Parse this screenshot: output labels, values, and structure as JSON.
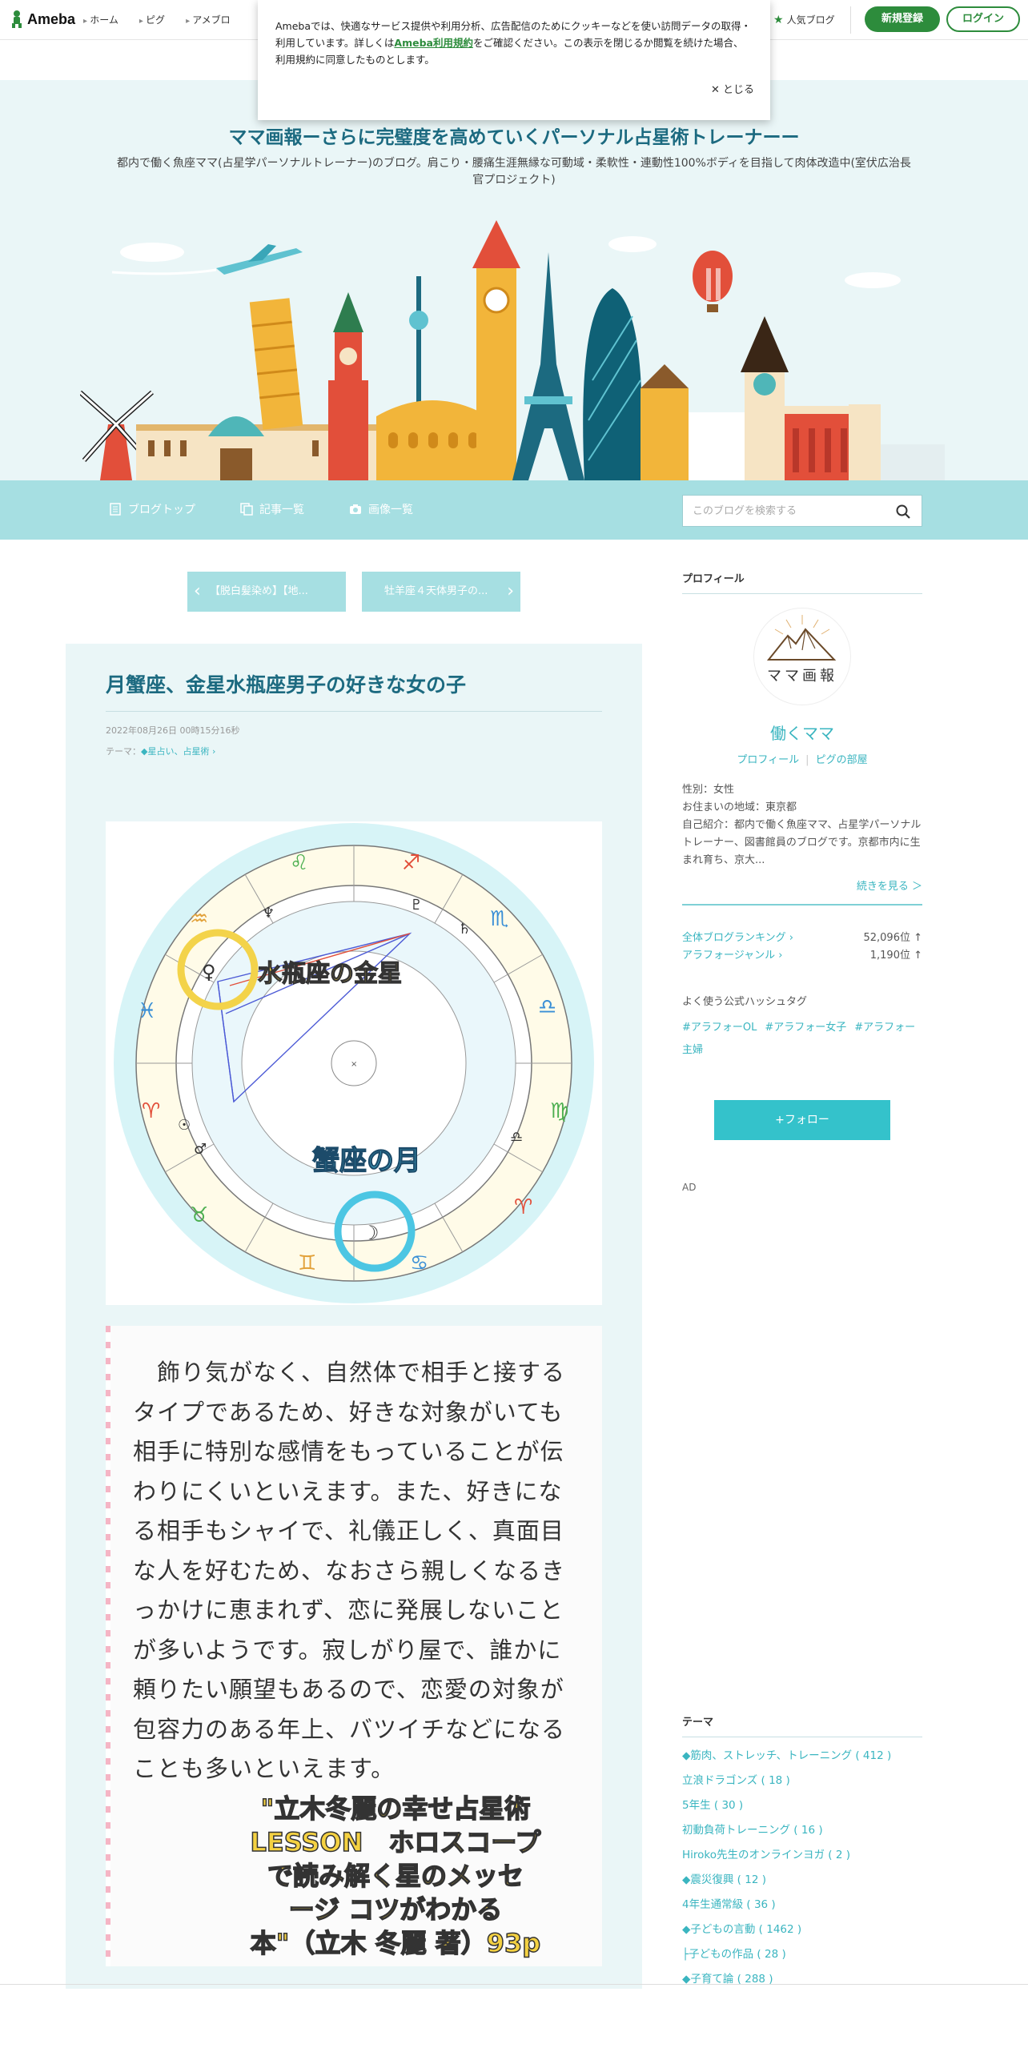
{
  "topbar": {
    "logo": "Ameba",
    "nav": [
      "ホーム",
      "ピグ",
      "アメブロ"
    ],
    "popular": "人気ブログ",
    "register": "新規登録",
    "login": "ログイン"
  },
  "cookie": {
    "text_before": "Amebaでは、快適なサービス提供や利用分析、広告配信のためにクッキーなどを使い訪問データの取得・利用しています。詳しくは",
    "link": "Ameba利用規約",
    "text_after": "をご確認ください。この表示を閉じるか閲覧を続けた場合、利用規約に同意したものとします。",
    "close": "✕ とじる"
  },
  "header": {
    "title": "ママ画報ーさらに完璧度を高めていくパーソナル占星術トレーナーー",
    "description": "都内で働く魚座ママ(占星学パーソナルトレーナー)のブログ。肩こり・腰痛生涯無縁な可動域・柔軟性・連動性100%ボディを目指して肉体改造中(室伏広治長官プロジェクト)"
  },
  "menubar": {
    "items": [
      "ブログトップ",
      "記事一覧",
      "画像一覧"
    ],
    "search_placeholder": "このブログを検索する"
  },
  "pager": {
    "prev": "【脱白髪染め】【地...",
    "next": "牡羊座４天体男子の..."
  },
  "article": {
    "title": "月蟹座、金星水瓶座男子の好きな女の子",
    "date": "2022年08月26日 00時15分16秒",
    "theme_label": "テーマ：",
    "theme": "◆星占い、占星術",
    "chart_labels": {
      "venus": "水瓶座の金星",
      "moon": "蟹座の月"
    },
    "quote": "　飾り気がなく、自然体で相手と接するタイプであるため、好きな対象がいても相手に特別な感情をもっていることが伝わりにくいといえます。また、好きになる相手もシャイで、礼儀正しく、真面目な人を好むため、なおさら親しくなるきっかけに恵まれず、恋に発展しないことが多いようです。寂しがり屋で、誰かに頼りたい願望もあるので、恋愛の対象が包容力のある年上、バツイチなどになることも多いといえます。",
    "book_lines": [
      "\"立木冬麗の幸せ占星術",
      "LESSON　ホロスコープ",
      "で読み解く星のメッセ",
      "ージ コツがわかる",
      "本\"（立木 冬麗 著）93p"
    ]
  },
  "sidebar": {
    "profile_heading": "プロフィール",
    "avatar_text": "ママ画報",
    "name": "働くママ",
    "profile_link": "プロフィール",
    "pig_link": "ピグの部屋",
    "gender": "性別：女性",
    "area": "お住まいの地域：東京都",
    "intro": "自己紹介：都内で働く魚座ママ、占星学パーソナルトレーナー、図書館員のブログです。京都市内に生まれ育ち、京大...",
    "more": "続きを見る ＞",
    "rankings": [
      {
        "label": "全体ブログランキング ›",
        "value": "52,096位 ↑"
      },
      {
        "label": "アラフォージャンル ›",
        "value": "1,190位 ↑"
      }
    ],
    "tags_heading": "よく使う公式ハッシュタグ",
    "tags": [
      "#アラフォーOL",
      "#アラフォー女子",
      "#アラフォー主婦"
    ],
    "follow": "+フォロー",
    "ad": "AD",
    "theme_heading": "テーマ",
    "themes": [
      "◆筋肉、ストレッチ、トレーニング ( 412 )",
      "立浪ドラゴンズ ( 18 )",
      "5年生 ( 30 )",
      "初動負荷トレーニング ( 16 )",
      "Hiroko先生のオンラインヨガ ( 2 )",
      "◆震災復興 ( 12 )",
      "4年生通常級 ( 36 )",
      "◆子どもの言動 ( 1462 )",
      "├子どもの作品 ( 28 )",
      "◆子育て論 ( 288 )"
    ]
  },
  "colors": {
    "brand": "#2d8c3c",
    "accent": "#3ab5c0",
    "menubar": "#a6dfe2",
    "header_bg": "#eaf6f7"
  }
}
